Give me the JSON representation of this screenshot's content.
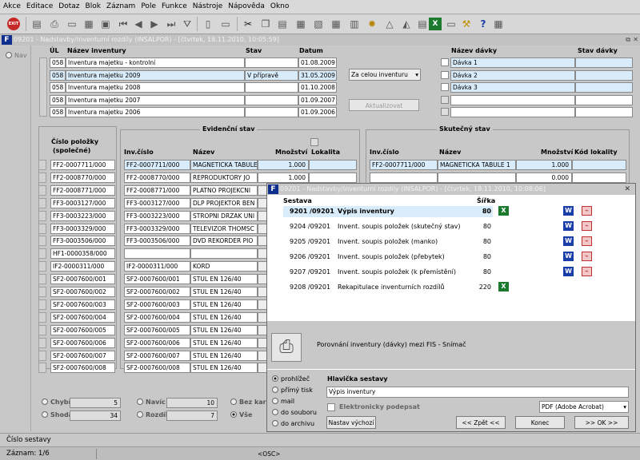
{
  "menu": [
    "Akce",
    "Editace",
    "Dotaz",
    "Blok",
    "Záznam",
    "Pole",
    "Funkce",
    "Nástroje",
    "Nápověda",
    "Okno"
  ],
  "toolbar": {
    "exit_label": "EXIT"
  },
  "main_window": {
    "title": "09201 - Nadstavby/Inventurní rozdíly (INSALPOR) - [čtvrtek, 18.11.2010, 10:05:59]",
    "nav_label": "Nav"
  },
  "inventory": {
    "headers": {
      "ul": "ÚL",
      "name": "Název inventury",
      "state": "Stav",
      "date": "Datum"
    },
    "rows": [
      {
        "ul": "058",
        "name": "Inventura majetku - kontrolní",
        "state": "",
        "date": "01.08.2009"
      },
      {
        "ul": "058",
        "name": "Inventura majetku 2009",
        "state": "V přípravě",
        "date": "31.05.2009"
      },
      {
        "ul": "058",
        "name": "Inventura majetku 2008",
        "state": "",
        "date": "01.10.2008"
      },
      {
        "ul": "058",
        "name": "Inventura majetku 2007",
        "state": "",
        "date": "01.09.2007"
      },
      {
        "ul": "058",
        "name": "Inventura majetku 2006",
        "state": "",
        "date": "01.09.2006"
      }
    ],
    "scope_select": "Za celou inventuru",
    "update_button": "Aktualizovat"
  },
  "batches": {
    "headers": {
      "name": "Název dávky",
      "state": "Stav dávky"
    },
    "rows": [
      "Dávka 1",
      "Dávka 2",
      "Dávka 3",
      "",
      ""
    ]
  },
  "items": {
    "header_line1": "Číslo položky",
    "header_line2": "(společné)",
    "rows": [
      "FF2-0007711/000",
      "FF2-0008770/000",
      "FF2-0008771/000",
      "FF3-0003127/000",
      "FF3-0003223/000",
      "FF3-0003329/000",
      "FF3-0003506/000",
      "HF1-0000358/000",
      "IF2-0000311/000",
      "SF2-0007600/001",
      "SF2-0007600/002",
      "SF2-0007600/003",
      "SF2-0007600/004",
      "SF2-0007600/005",
      "SF2-0007600/006",
      "SF2-0007600/007",
      "SF2-0007600/008"
    ]
  },
  "recorded": {
    "title": "Evidenční stav",
    "headers": {
      "inv": "Inv.číslo",
      "name": "Název",
      "qty": "Množství",
      "loc": "Lokalita"
    },
    "rows": [
      {
        "inv": "FF2-0007711/000",
        "name": "MAGNETICKA TABULE",
        "qty": "1.000"
      },
      {
        "inv": "FF2-0008770/000",
        "name": "REPRODUKTORY JO",
        "qty": "1.000"
      },
      {
        "inv": "FF2-0008771/000",
        "name": "PLATNO PROJEKCNI",
        "qty": ""
      },
      {
        "inv": "FF3-0003127/000",
        "name": "DLP PROJEKTOR BEN",
        "qty": ""
      },
      {
        "inv": "FF3-0003223/000",
        "name": "STROPNI DRZAK UNI",
        "qty": ""
      },
      {
        "inv": "FF3-0003329/000",
        "name": "TELEVIZOR THOMSC",
        "qty": ""
      },
      {
        "inv": "FF3-0003506/000",
        "name": "DVD REKORDER PIO",
        "qty": ""
      },
      {
        "inv": "",
        "name": "",
        "qty": ""
      },
      {
        "inv": "IF2-0000311/000",
        "name": "KORD",
        "qty": ""
      },
      {
        "inv": "SF2-0007600/001",
        "name": "STUL EN 126/40",
        "qty": ""
      },
      {
        "inv": "SF2-0007600/002",
        "name": "STUL EN 126/40",
        "qty": ""
      },
      {
        "inv": "SF2-0007600/003",
        "name": "STUL EN 126/40",
        "qty": ""
      },
      {
        "inv": "SF2-0007600/004",
        "name": "STUL EN 126/40",
        "qty": ""
      },
      {
        "inv": "SF2-0007600/005",
        "name": "STUL EN 126/40",
        "qty": ""
      },
      {
        "inv": "SF2-0007600/006",
        "name": "STUL EN 126/40",
        "qty": ""
      },
      {
        "inv": "SF2-0007600/007",
        "name": "STUL EN 126/40",
        "qty": ""
      },
      {
        "inv": "SF2-0007600/008",
        "name": "STUL EN 126/40",
        "qty": ""
      }
    ]
  },
  "actual": {
    "title": "Skutečný stav",
    "headers": {
      "inv": "Inv.číslo",
      "name": "Název",
      "qty": "Množství",
      "loc": "Kód lokality"
    },
    "rows": [
      {
        "inv": "FF2-0007711/000",
        "name": "MAGNETICKA TABULE 1",
        "qty": "1.000"
      },
      {
        "inv": "",
        "name": "",
        "qty": "0.000"
      }
    ]
  },
  "summary": {
    "missing_label": "Chybí",
    "missing_value": "5",
    "surplus_label": "Navíc",
    "surplus_value": "10",
    "match_label": "Shoda",
    "match_value": "34",
    "diff_label": "Rozdíl",
    "diff_value": "7",
    "nocard_label": "Bez kar",
    "all_label": "Vše"
  },
  "dialog": {
    "title": "09201 - Nadstavby/Inventurní rozdíly (INSALPOR) - [čtvrtek, 18.11.2010, 10:08:06]",
    "col_report": "Sestava",
    "col_width": "Šířka",
    "reports": [
      {
        "code": "9201 /09201",
        "name": "Výpis inventury",
        "width": "80",
        "xls": true,
        "word": true,
        "pdf": true
      },
      {
        "code": "9204 /09201",
        "name": "Invent. soupis položek (skutečný stav)",
        "width": "80",
        "xls": false,
        "word": true,
        "pdf": true
      },
      {
        "code": "9205 /09201",
        "name": "Invent. soupis položek (manko)",
        "width": "80",
        "xls": false,
        "word": true,
        "pdf": true
      },
      {
        "code": "9206 /09201",
        "name": "Invent. soupis položek (přebytek)",
        "width": "80",
        "xls": false,
        "word": true,
        "pdf": true
      },
      {
        "code": "9207 /09201",
        "name": "Invent. soupis položek (k přemístění)",
        "width": "80",
        "xls": false,
        "word": true,
        "pdf": true
      },
      {
        "code": "9208 /09201",
        "name": "Rekapitulace inventurních rozdílů",
        "width": "220",
        "xls": true,
        "word": false,
        "pdf": false
      }
    ],
    "description": "Porovnání inventury (dávky) mezi FIS - Snímač",
    "outputs": [
      "prohlížeč",
      "přímý tisk",
      "mail",
      "do souboru",
      "do archivu"
    ],
    "header_label": "Hlavička sestavy",
    "header_value": "Výpis inventury",
    "sign_label": "Elektronicky podepsat",
    "format_value": "PDF (Adobe Acrobat)",
    "defaults_button": "Nastav výchozí",
    "back_button": "<< Zpět <<",
    "end_button": "Konec",
    "ok_button": ">> OK >>"
  },
  "statusbar": {
    "field_label": "Číslo sestavy",
    "record": "Záznam: 1/6",
    "osc": "<OSC>"
  }
}
